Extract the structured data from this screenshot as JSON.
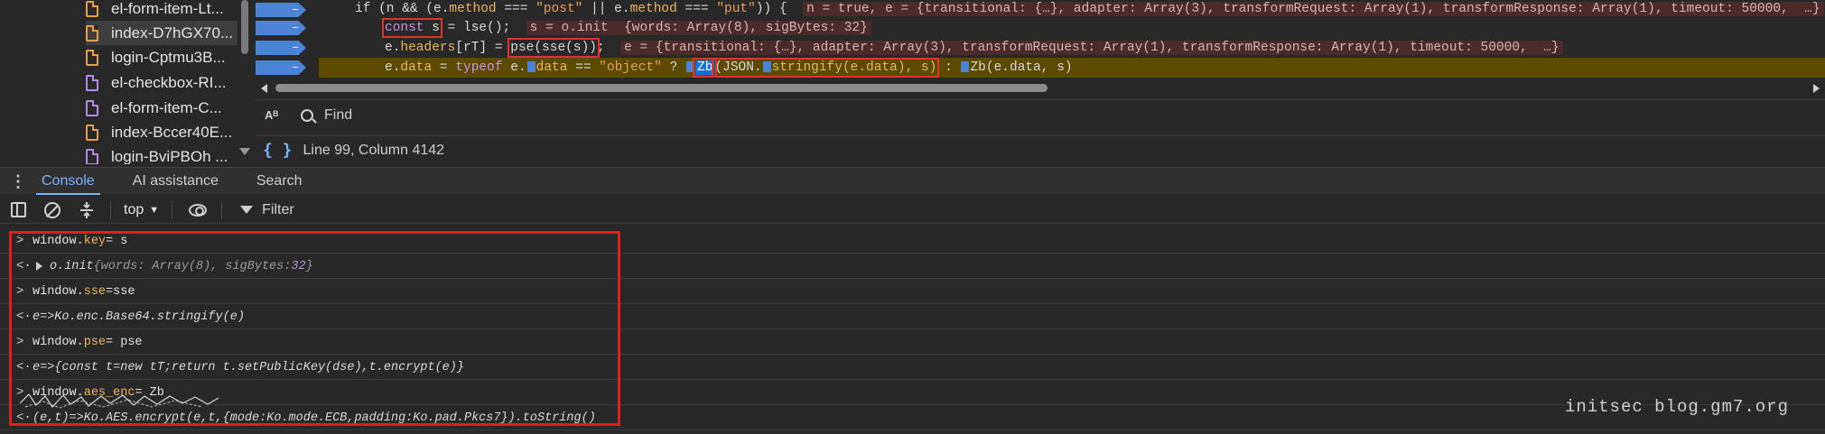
{
  "files": [
    {
      "name": "el-form-item-Lt...",
      "color": "orange"
    },
    {
      "name": "index-D7hGX70...",
      "color": "orange",
      "selected": true
    },
    {
      "name": "login-Cptmu3B...",
      "color": "orange"
    },
    {
      "name": "el-checkbox-RI...",
      "color": "purple"
    },
    {
      "name": "el-form-item-C...",
      "color": "purple"
    },
    {
      "name": "index-Bccer40E...",
      "color": "orange"
    },
    {
      "name": "login-BviPBOh ...",
      "color": "purple"
    }
  ],
  "editor": {
    "line1": {
      "code_a": "if (n && (e.",
      "method1": "method",
      "code_b": " === ",
      "post": "\"post\"",
      "code_c": " || e.",
      "method2": "method",
      "code_d": " === ",
      "put": "\"put\"",
      "code_e": ")) {",
      "inline": "n = true, e = {transitional: {…}, adapter: Array(3), transformRequest: Array(1), transformResponse: Array(1), timeout: 50000,  …}"
    },
    "line2": {
      "const_kw": "const",
      "var": "s",
      "code": " = lse();",
      "inline": "s = o.init  {words: Array(8), sigBytes: 32}"
    },
    "line3": {
      "code_a": "e.",
      "headers": "headers",
      "code_b": "[rT] = ",
      "boxed": "pse(sse(s))",
      "code_c": ";",
      "inline": "e = {transitional: {…}, adapter: Array(3), transformRequest: Array(1), transformResponse: Array(1), timeout: 50000,  …}"
    },
    "line4": {
      "code_a": "e.",
      "data1": "data",
      "code_b": " = ",
      "typeof": "typeof",
      "code_c": " e.",
      "data2": "data",
      "code_d": " == ",
      "object": "\"object\"",
      "code_e": " ? ",
      "zb": "Zb",
      "code_f": "(JSON.",
      "stringify": "stringify(e.data), s)",
      "code_g": " : ",
      "zb2": "Zb(e.data, s)"
    },
    "bp_symbol": "–"
  },
  "find": {
    "case_label": "Aᴮ",
    "placeholder": "Find"
  },
  "status": {
    "braces": "{ }",
    "position": "Line 99, Column 4142"
  },
  "drawer": {
    "menu_glyph": "⋮",
    "tabs": [
      "Console",
      "AI assistance",
      "Search"
    ]
  },
  "toolbar": {
    "context": "top",
    "caret": "▼",
    "filter": "Filter"
  },
  "console": {
    "r1": {
      "a": "window.",
      "b": "key",
      "c": " = s"
    },
    "r2": {
      "a": "o.init",
      "b": "  {words: Array(8), sigBytes: ",
      "c": "32",
      "d": "}"
    },
    "r3": {
      "a": "window.",
      "b": "sse",
      "c": " =sse"
    },
    "r4": {
      "a": "e=>Ko.enc.Base64.stringify(e)"
    },
    "r5": {
      "a": "window.",
      "b": "pse",
      "c": " = pse"
    },
    "r6": {
      "a": "e=>{const t=new tT;return t.setPublicKey(dse),t.encrypt(e)}"
    },
    "r7": {
      "a": "window.",
      "b": "aes_enc",
      "c": " = Zb"
    },
    "r8": {
      "a": "(e,t)=>Ko.AES.encrypt(e,t,{mode:Ko.mode.ECB,padding:Ko.pad.Pkcs7}).toString()"
    },
    "prompt_in": ">",
    "prompt_out": "<·"
  },
  "watermark": "initsec blog.gm7.org",
  "colors": {
    "accent": "#7ab3ff",
    "highlight": "#5b4a00",
    "frame": "#e01e1e",
    "breakpoint": "#4b83d6"
  }
}
